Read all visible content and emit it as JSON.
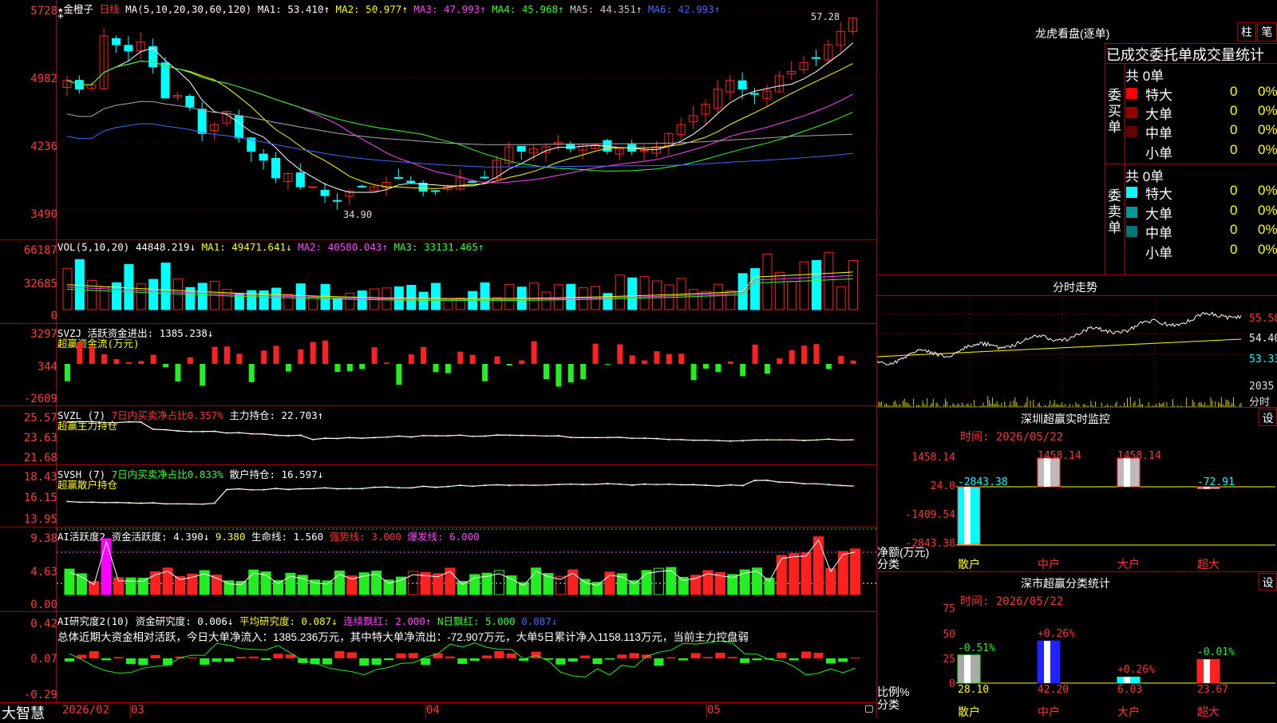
{
  "stock": {
    "star": "★",
    "name": "金橙子",
    "period": "日线"
  },
  "main_panel": {
    "ma_label": "MA(5,10,20,30,60,120)",
    "ma1": "MA1: 53.410↑",
    "ma2": "MA2: 50.977↑",
    "ma3": "MA3: 47.993↑",
    "ma4": "MA4: 45.968↑",
    "ma5": "MA5: 44.351↑",
    "ma6": "MA6: 42.993↑",
    "y_ticks": [
      "5728",
      "4982",
      "4236",
      "3490"
    ],
    "high_label": "57.28",
    "low_label": "34.90",
    "plus": "+"
  },
  "vol_panel": {
    "label": "VOL(5,10,20)",
    "value": "44848.219↓",
    "ma1": "MA1: 49471.641↓",
    "ma2": "MA2: 40580.043↑",
    "ma3": "MA3: 33131.465↑",
    "y_ticks": [
      "66187",
      "32685",
      "0"
    ]
  },
  "svzj_panel": {
    "label": "SVZJ",
    "desc": "活跃资金进出: 1385.238↓",
    "sub": "超赢资金流(万元)",
    "y_ticks": [
      "3297",
      "344",
      "-2609"
    ]
  },
  "svzl_panel": {
    "label": "SVZL (7)",
    "desc": "7日内买卖净占比0.357%",
    "hold": "主力持仓: 22.703↑",
    "sub": "超赢主力持仓",
    "y_ticks": [
      "25.57",
      "23.63",
      "21.68"
    ]
  },
  "svsh_panel": {
    "label": "SVSH (7)",
    "desc": "7日内买卖净占比0.833%",
    "hold": "散户持仓: 16.597↓",
    "sub": "超赢散户持仓",
    "y_ticks": [
      "18.43",
      "16.15",
      "13.95"
    ]
  },
  "ai_active_panel": {
    "label": "AI活跃度2",
    "v1": "资金活跃度: 4.390↓",
    "v2": "9.380",
    "v3": "生命线: 1.560",
    "v4": "强势线: 3.000",
    "v5": "爆发线: 6.000",
    "y_ticks": [
      "9.38",
      "4.63",
      "0.00"
    ]
  },
  "ai_research_panel": {
    "label": "AI研究度2(10)",
    "v1": "资金研究度: 0.006↓",
    "v2": "平均研究度: 0.087↓",
    "v3": "连续飘红: 2.000↑",
    "v4": "N日飘红: 5.000",
    "v5": "0.087↓",
    "summary": "总体近期大资金相对活跃，今日大单净流入：1385.236万元，其中特大单净流出：-72.907万元，大单5日累计净入1158.113万元，当前主力控盘弱",
    "y_ticks": [
      "0.42",
      "0.07",
      "-0.29"
    ]
  },
  "bottom_axis": {
    "brand": "大智慧",
    "dates": [
      "2026/02",
      "03",
      "04",
      "05"
    ]
  },
  "right_top": {
    "title": "龙虎看盘(逐单)",
    "tab1": "柱",
    "tab2": "笔",
    "header": "已成交委托单成交量统计",
    "buy_label": "委买单",
    "sell_label": "委卖单",
    "buy_total": "共 0单",
    "sell_total": "共 0单",
    "buy_rows": [
      {
        "name": "特大",
        "count": "0",
        "pct": "0%",
        "color": "#ff0000"
      },
      {
        "name": "大单",
        "count": "0",
        "pct": "0%",
        "color": "#990000"
      },
      {
        "name": "中单",
        "count": "0",
        "pct": "0%",
        "color": "#660000"
      },
      {
        "name": "小单",
        "count": "0",
        "pct": "0%",
        "color": "#000000"
      }
    ],
    "sell_rows": [
      {
        "name": "特大",
        "count": "0",
        "pct": "0%",
        "color": "#00ffff"
      },
      {
        "name": "大单",
        "count": "0",
        "pct": "0%",
        "color": "#009999"
      },
      {
        "name": "中单",
        "count": "0",
        "pct": "0%",
        "color": "#007777"
      },
      {
        "name": "小单",
        "count": "0",
        "pct": "0%",
        "color": "#000000"
      }
    ]
  },
  "intraday": {
    "title": "分时走势",
    "y_ticks": [
      "55.58",
      "54.40",
      "53.33"
    ],
    "vol_tick": "2035",
    "vol_unit": "分时"
  },
  "sz_monitor": {
    "title": "深圳超赢实时监控",
    "set": "设",
    "time": "时间: 2026/05/22",
    "y_ticks": [
      "1458.14",
      "24.0",
      "-1409.54",
      "-2843.38"
    ],
    "ylabel": "净额(万元)",
    "xlabel": "分类",
    "categories": [
      "散户",
      "中户",
      "大户",
      "超大"
    ],
    "values": [
      "-2843.38",
      "1458.14",
      "1458.14",
      "-72.91"
    ]
  },
  "sz_class": {
    "title": "深市超赢分类统计",
    "set": "设",
    "time": "时间: 2026/05/22",
    "y_ticks": [
      "75",
      "50",
      "25",
      "0"
    ],
    "ylabel": "比例%",
    "xlabel": "分类",
    "categories": [
      "散户",
      "中户",
      "大户",
      "超大"
    ],
    "values": [
      "28.10",
      "42.20",
      "6.03",
      "23.67"
    ],
    "changes": [
      "-0.51%",
      "+0.26%",
      "+0.26%",
      "-0.01%"
    ]
  },
  "chart_data": [
    {
      "type": "candlestick",
      "title": "金橙子 日线",
      "ylim": [
        34.9,
        57.28
      ],
      "y_ticks": [
        57.28,
        49.82,
        42.36,
        34.9
      ],
      "high": 57.28,
      "low": 34.9,
      "ma_last": {
        "MA1": 53.41,
        "MA2": 50.977,
        "MA3": 47.993,
        "MA4": 45.968,
        "MA5": 44.351,
        "MA6": 42.993
      },
      "closes": [
        49.5,
        48.5,
        49.0,
        54.5,
        53.5,
        52.8,
        53.8,
        51.0,
        47.5,
        47.8,
        46.5,
        43.5,
        44.5,
        46.0,
        43.0,
        41.5,
        40.5,
        38.5,
        39.0,
        37.5,
        37.5,
        36.5,
        35.9,
        37.0,
        37.5,
        37.5,
        38.0,
        38.5,
        38.0,
        37.0,
        37.0,
        37.5,
        38.5,
        38.0,
        38.5,
        40.5,
        42.0,
        41.5,
        41.8,
        42.0,
        42.5,
        41.8,
        42.3,
        42.2,
        41.5,
        41.8,
        41.5,
        41.6,
        42.0,
        43.5,
        44.5,
        45.5,
        46.8,
        48.5,
        49.5,
        48.5,
        48.0,
        48.3,
        50.0,
        50.5,
        51.5,
        52.0,
        53.5,
        55.0,
        56.5
      ]
    },
    {
      "type": "bar",
      "title": "VOL(5,10,20)",
      "ylim": [
        0,
        66187
      ]
    },
    {
      "type": "bar",
      "title": "SVZJ 活跃资金进出",
      "ylim": [
        -2609,
        3297
      ]
    },
    {
      "type": "line",
      "title": "SVZL 主力持仓",
      "ylim": [
        21.68,
        25.57
      ],
      "last": 22.703
    },
    {
      "type": "line",
      "title": "SVSH 散户持仓",
      "ylim": [
        13.95,
        18.43
      ],
      "last": 16.597
    },
    {
      "type": "bar",
      "title": "AI活跃度2",
      "ylim": [
        0,
        9.38
      ],
      "last": 4.39
    },
    {
      "type": "bar",
      "title": "AI研究度2(10)",
      "ylim": [
        -0.29,
        0.42
      ],
      "last": 0.006
    },
    {
      "type": "bar",
      "title": "深圳超赢实时监控",
      "categories": [
        "散户",
        "中户",
        "大户",
        "超大"
      ],
      "values": [
        -2843.38,
        1458.14,
        1458.14,
        -72.91
      ],
      "ylabel": "净额(万元)",
      "xlabel": "分类"
    },
    {
      "type": "bar",
      "title": "深市超赢分类统计",
      "categories": [
        "散户",
        "中户",
        "大户",
        "超大"
      ],
      "values": [
        28.1,
        42.2,
        6.03,
        23.67
      ],
      "ylabel": "比例%",
      "xlabel": "分类",
      "ylim": [
        0,
        75
      ]
    }
  ],
  "colors": {
    "up": "#ff2020",
    "down": "#00ffff",
    "grid": "#b00000",
    "ma1": "#ffffff",
    "ma2": "#ffff00",
    "ma3": "#ff44ff",
    "ma4": "#33ff33",
    "ma5": "#aaaaaa",
    "ma6": "#4466ff"
  }
}
